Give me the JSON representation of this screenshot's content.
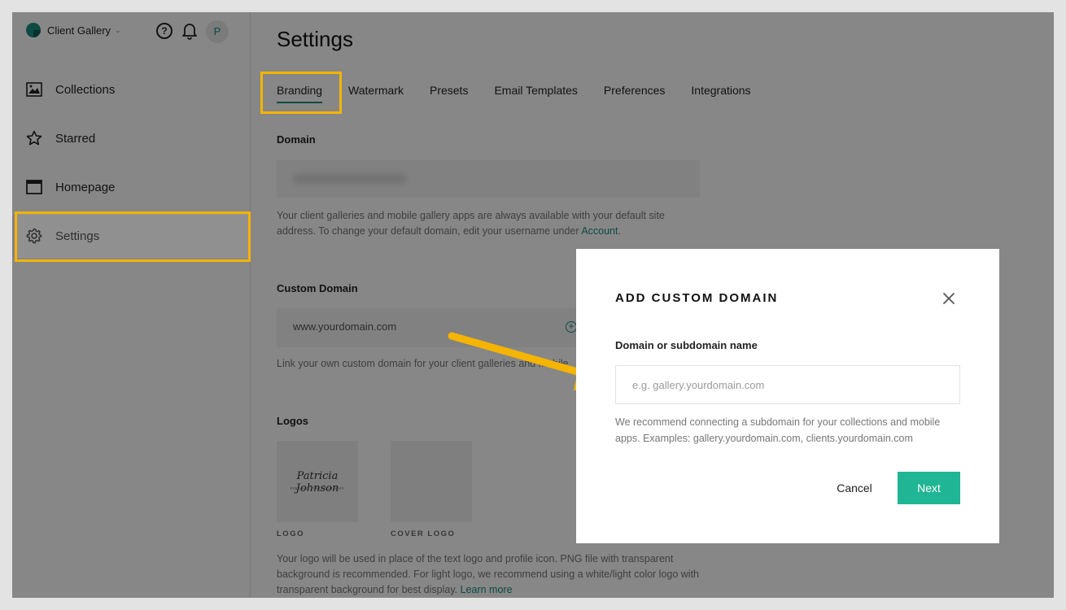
{
  "app": {
    "brand_name": "Client Gallery",
    "help_glyph": "?",
    "avatar_initial": "P"
  },
  "sidebar": {
    "items": [
      {
        "label": "Collections",
        "icon": "image-icon"
      },
      {
        "label": "Starred",
        "icon": "star-icon"
      },
      {
        "label": "Homepage",
        "icon": "browser-window-icon"
      },
      {
        "label": "Settings",
        "icon": "gear-icon"
      }
    ],
    "active": "Settings"
  },
  "main": {
    "title": "Settings",
    "tabs": [
      {
        "label": "Branding"
      },
      {
        "label": "Watermark"
      },
      {
        "label": "Presets"
      },
      {
        "label": "Email Templates"
      },
      {
        "label": "Preferences"
      },
      {
        "label": "Integrations"
      }
    ],
    "active_tab": "Branding",
    "domain": {
      "label": "Domain",
      "help_text": "Your client galleries and mobile gallery apps are always available with your default site address. To change your default domain, edit your username under ",
      "help_link": "Account",
      "help_suffix": "."
    },
    "custom_domain": {
      "label": "Custom Domain",
      "value": "www.yourdomain.com",
      "help_text": "Link your own custom domain for your client galleries and mobile"
    },
    "logos": {
      "label": "Logos",
      "signature_text": "Patricia Johnson",
      "signature_sub": "FINE ART PHOTOGRAPHY",
      "logo_caption": "LOGO",
      "cover_caption": "COVER LOGO",
      "help_text": "Your logo will be used in place of the text logo and profile icon. PNG file with transparent background is recommended. For light logo, we recommend using a white/light color logo with transparent background for best display. ",
      "help_link": "Learn more"
    }
  },
  "modal": {
    "title": "ADD CUSTOM DOMAIN",
    "field_label": "Domain or subdomain name",
    "field_placeholder": "e.g. gallery.yourdomain.com",
    "field_value": "",
    "help_text": "We recommend connecting a subdomain for your collections and mobile apps. Examples: gallery.yourdomain.com, clients.yourdomain.com",
    "cancel_label": "Cancel",
    "next_label": "Next"
  },
  "colors": {
    "accent": "#1a8f7f",
    "primary_button": "#20b595",
    "highlight": "#f4b400",
    "overlay": "rgba(0,0,0,0.47)"
  }
}
